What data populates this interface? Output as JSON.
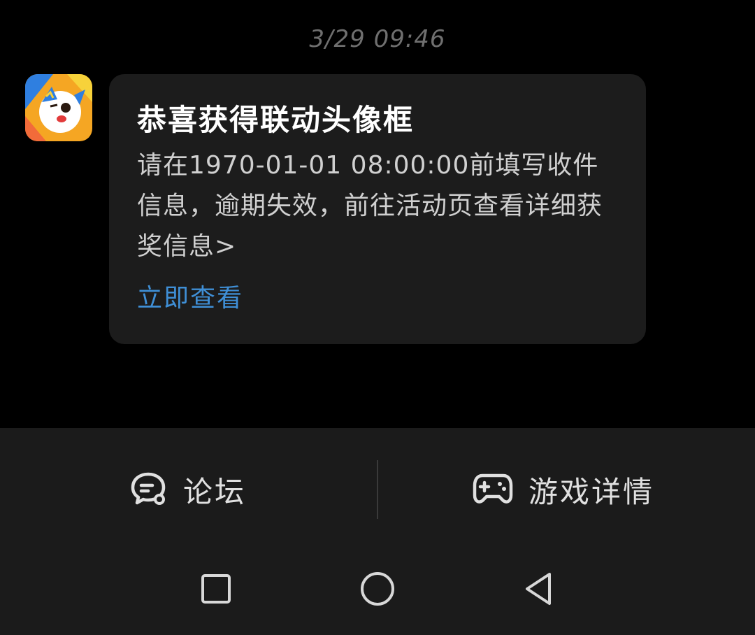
{
  "header": {
    "timestamp": "3/29  09:46"
  },
  "message": {
    "avatar_icon": "game-app-avatar-icon",
    "title": "恭喜获得联动头像框",
    "body": "请在1970-01-01 08:00:00前填写收件信息，逾期失效，前往活动页查看详细获奖信息>",
    "action_label": "立即查看"
  },
  "bottom_bar": {
    "forum_label": "论坛",
    "forum_icon": "chat-bubble-icon",
    "game_details_label": "游戏详情",
    "game_details_icon": "gamepad-icon"
  },
  "nav_bar": {
    "recents_icon": "square-icon",
    "home_icon": "circle-icon",
    "back_icon": "triangle-back-icon"
  },
  "colors": {
    "background": "#000000",
    "card": "#1c1c1c",
    "bar": "#1b1b1b",
    "link": "#3f8fd6",
    "timestamp": "#6f6f6f"
  }
}
